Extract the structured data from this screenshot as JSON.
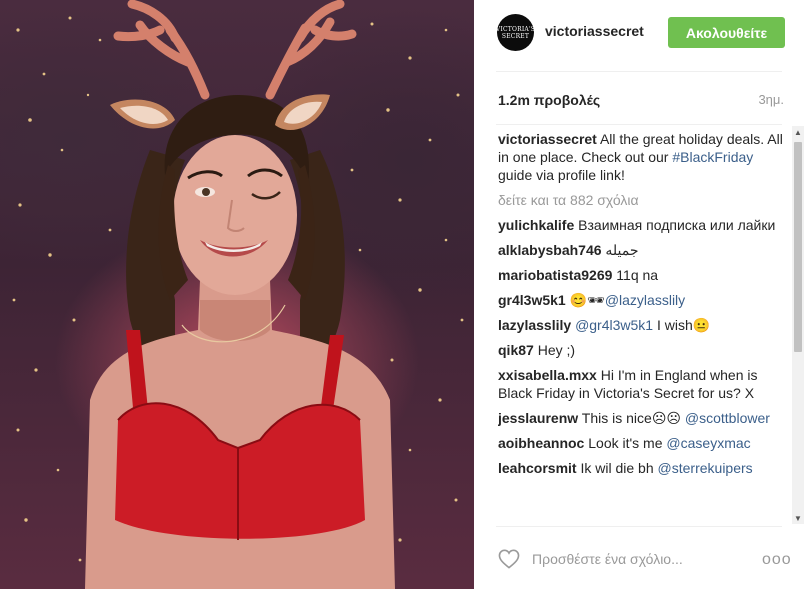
{
  "header": {
    "avatar_text": "VICTORIA'S SECRET",
    "username": "victoriassecret",
    "follow_label": "Ακολουθείτε"
  },
  "stats": {
    "views": "1.2m προβολές",
    "time": "3ημ."
  },
  "caption": {
    "username": "victoriassecret",
    "text_before": "All the great holiday deals. All in one place. Check out our",
    "hashtag": "#BlackFriday",
    "text_after": "guide via profile link!"
  },
  "load_more": "δείτε και τα 882 σχόλια",
  "comments": [
    {
      "user": "yulichkalife",
      "text": "Взаимная подписка или лайки"
    },
    {
      "user": "alklabysbah746",
      "text": "جميله"
    },
    {
      "user": "mariobatista9269",
      "text": "11q na"
    },
    {
      "user": "gr4l3w5k1",
      "text": "😊🕶",
      "mention": "@lazylasslily"
    },
    {
      "user": "lazylasslily",
      "mention": "@gr4l3w5k1",
      "text_after": "I wish😐"
    },
    {
      "user": "qik87",
      "text": "Hey ;)"
    },
    {
      "user": "xxisabella.mxx",
      "text": "Hi I'm in England when is Black Friday in Victoria's Secret for us? X"
    },
    {
      "user": "jesslaurenw",
      "text": "This is nice☹☹",
      "mention": "@scottblower"
    },
    {
      "user": "aoibheannoc",
      "text": "Look it's me",
      "mention": "@caseyxmac"
    },
    {
      "user": "leahcorsmit",
      "text": "Ik wil die bh",
      "mention": "@sterrekuipers"
    }
  ],
  "footer": {
    "placeholder": "Προσθέστε ένα σχόλιο...",
    "more": "ooo"
  },
  "colors": {
    "follow_green": "#70c050",
    "link_blue": "#3b5f8a",
    "muted_gray": "#999999"
  },
  "icons": [
    "heart-icon",
    "more-options-icon",
    "scroll-up-icon",
    "scroll-down-icon"
  ]
}
